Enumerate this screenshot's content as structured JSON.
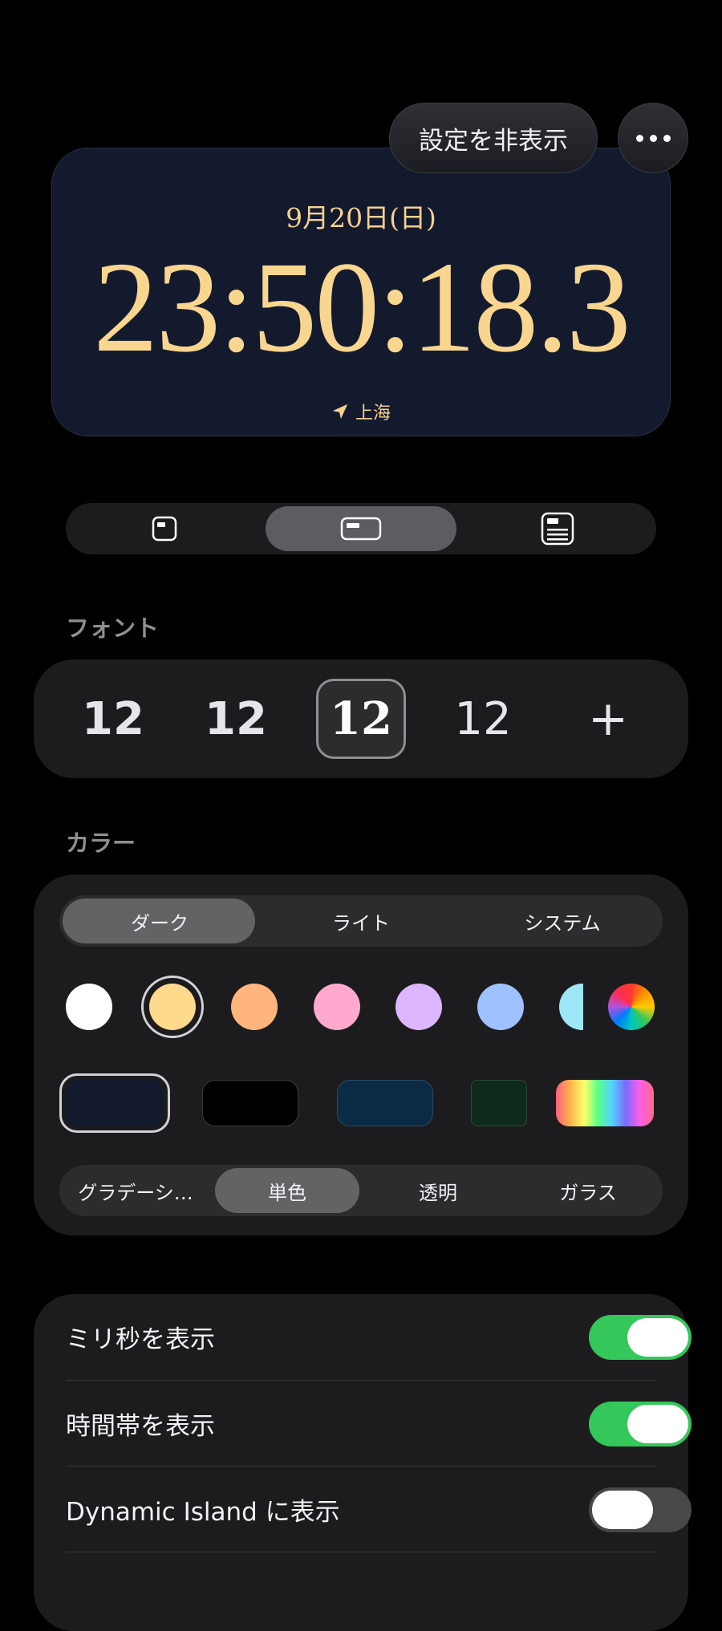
{
  "header": {
    "hide_settings_label": "設定を非表示",
    "more_icon": "ellipsis-icon"
  },
  "clock": {
    "date": "9月20日(日)",
    "time": "23:50:18.3",
    "location": "上海",
    "location_icon": "location-arrow-icon"
  },
  "layout": {
    "options": [
      "small-widget-icon",
      "wide-widget-icon",
      "large-widget-icon"
    ],
    "selected_index": 1
  },
  "font": {
    "section_label": "フォント",
    "options": [
      "12",
      "12",
      "12",
      "12"
    ],
    "selected_index": 2,
    "add_label": "+"
  },
  "color": {
    "section_label": "カラー",
    "theme_tabs": [
      "ダーク",
      "ライト",
      "システム"
    ],
    "theme_selected_index": 0,
    "accent_swatches": [
      "#ffffff",
      "#ffd98c",
      "#ffb57c",
      "#ffa9cf",
      "#dcb6ff",
      "#9fc1ff",
      "#9ee7f7",
      "rainbow"
    ],
    "accent_selected_index": 1,
    "background_swatches": [
      "#141a2e",
      "#000000",
      "#0b2a44",
      "#0e2a1b",
      "rainbow"
    ],
    "background_selected_index": 0,
    "style_tabs": [
      "グラデーシ…",
      "単色",
      "透明",
      "ガラス"
    ],
    "style_selected_index": 1,
    "colors": {
      "accent_green": "#34c759",
      "clock_gold": "#f9d68f"
    }
  },
  "toggles": [
    {
      "label": "ミリ秒を表示",
      "on": true
    },
    {
      "label": "時間帯を表示",
      "on": true
    },
    {
      "label": "Dynamic Island に表示",
      "on": false
    }
  ]
}
